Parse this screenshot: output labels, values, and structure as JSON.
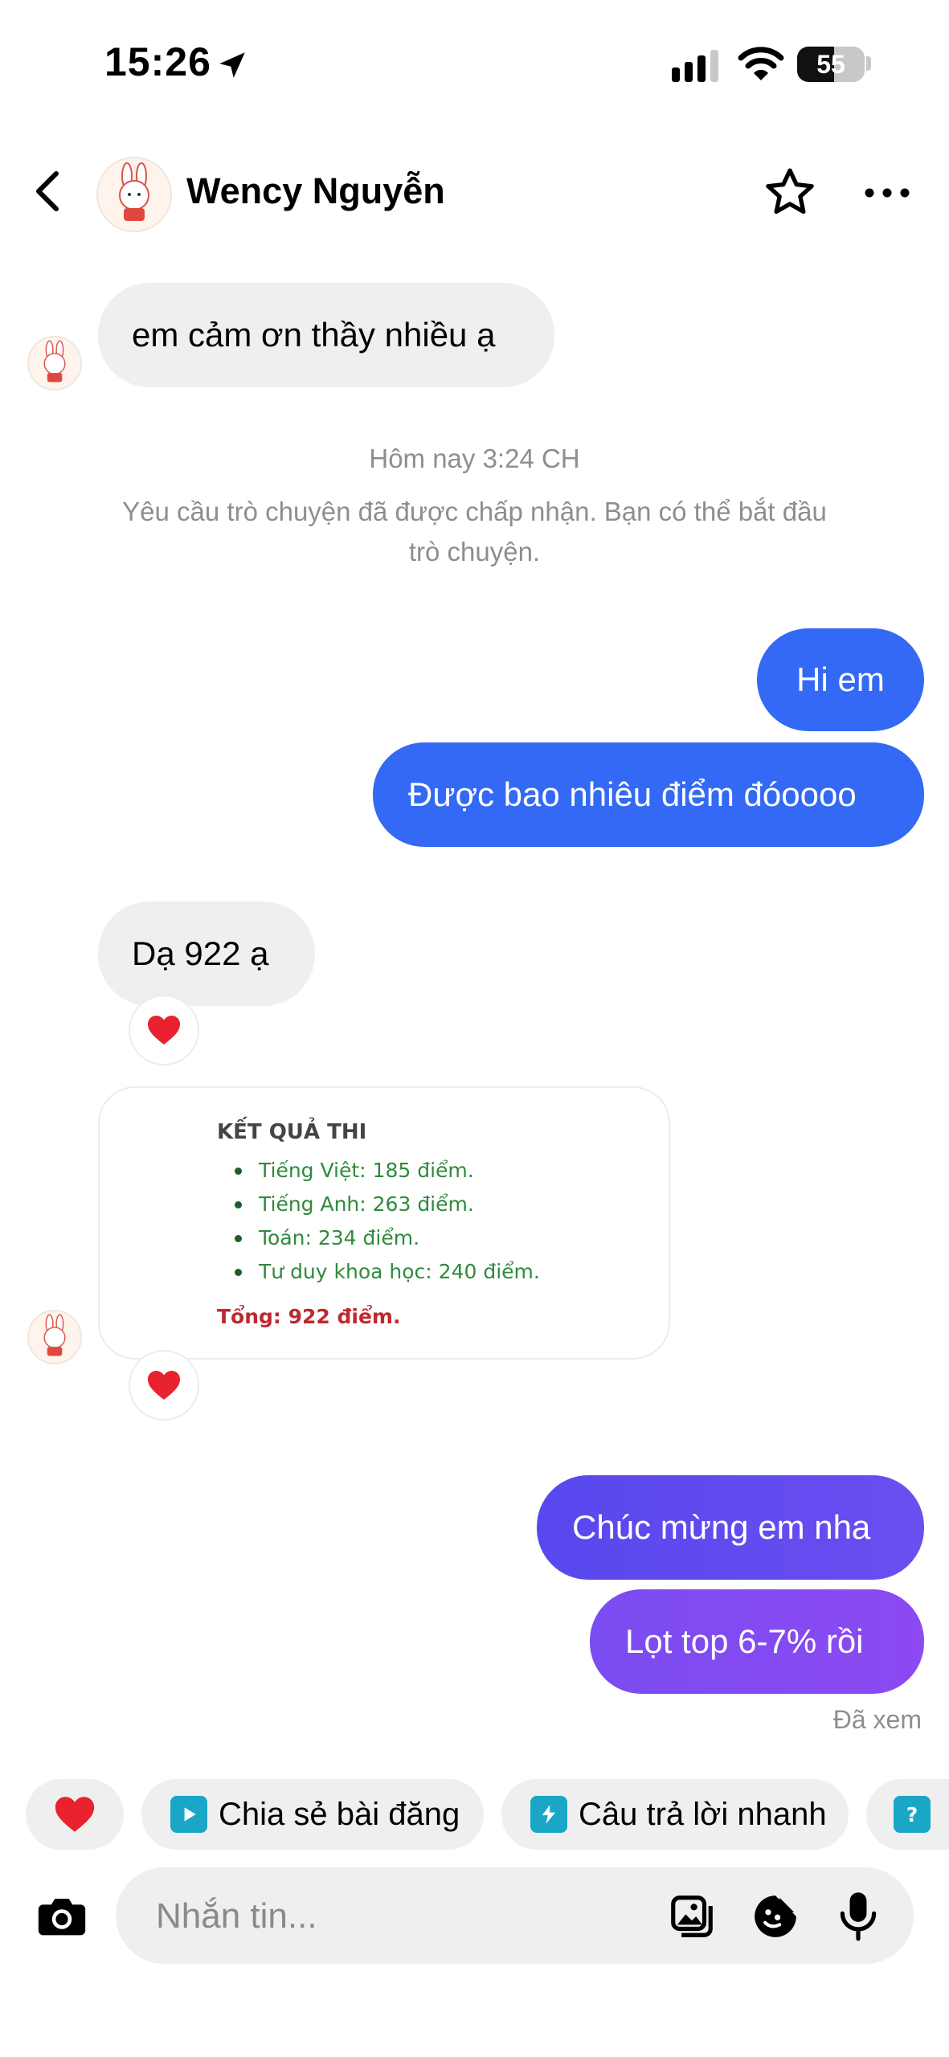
{
  "status_bar": {
    "time": "15:26",
    "battery": "55",
    "battery_level": 0.55
  },
  "header": {
    "contact_name": "Wency Nguyễn"
  },
  "messages": {
    "first_incoming": "em cảm ơn thầy nhiều ạ",
    "timestamp": "Hôm nay 3:24 CH",
    "system_line1": "Yêu cầu trò chuyện đã được chấp nhận. Bạn có thể bắt đầu",
    "system_line2": "trò chuyện.",
    "out1": "Hi em",
    "out2": "Được bao nhiêu điểm đóoooo",
    "in2": "Dạ 922 ạ",
    "card": {
      "title": "KẾT QUẢ THI",
      "items": [
        "Tiếng Việt: 185 điểm.",
        "Tiếng Anh: 263 điểm.",
        "Toán: 234 điểm.",
        "Tư duy khoa học: 240 điểm."
      ],
      "total": "Tổng: 922 điểm."
    },
    "out3": "Chúc mừng em nha",
    "out4": "Lọt top 6-7% rồi",
    "seen": "Đã xem"
  },
  "quick_replies": {
    "share": "Chia sẻ bài đăng",
    "quick_answer": "Câu trả lời nhanh"
  },
  "composer": {
    "placeholder": "Nhắn tin..."
  },
  "colors": {
    "outgoing_blue": "#3369f5",
    "outgoing_purple_start": "#5f50ef",
    "outgoing_purple_end": "#8a49f2",
    "incoming_bg": "#efefef",
    "heart": "#e8222e"
  }
}
